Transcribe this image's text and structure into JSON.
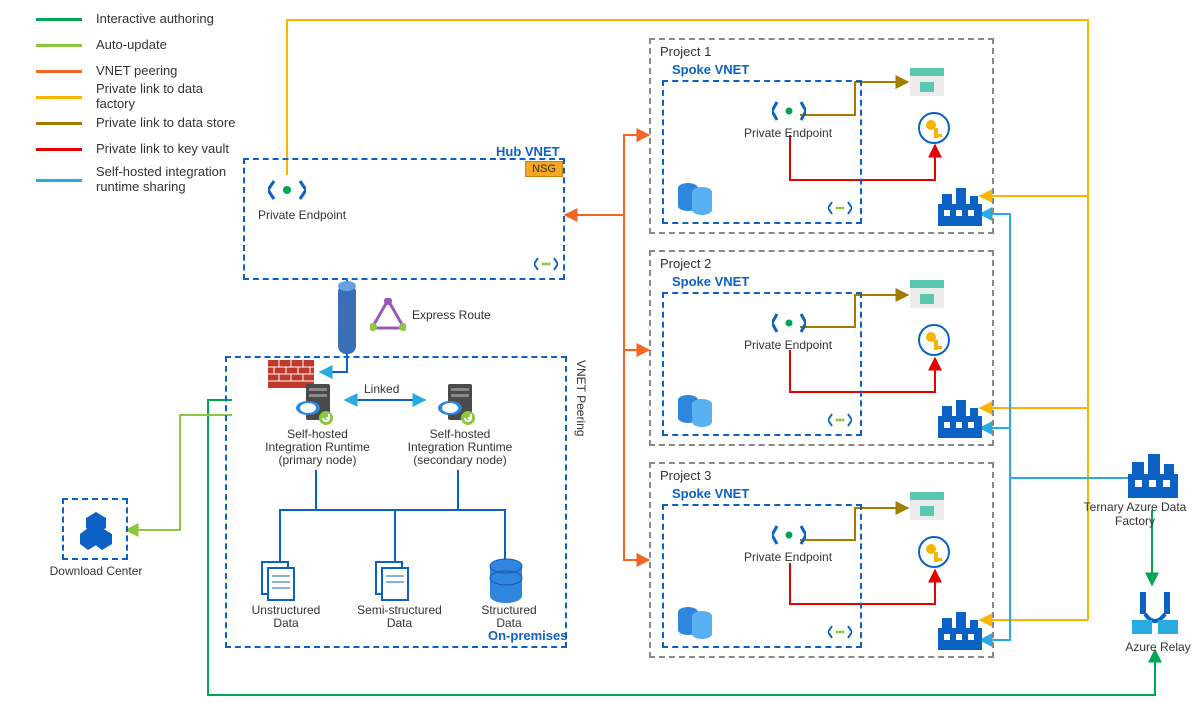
{
  "legend": {
    "items": [
      {
        "label": "Interactive authoring",
        "color": "#00a651"
      },
      {
        "label": "Auto-update",
        "color": "#8dc63f"
      },
      {
        "label": "VNET peering",
        "color": "#f26522"
      },
      {
        "label": "Private link to data factory",
        "color": "#f7b500"
      },
      {
        "label": "Private link to data store",
        "color": "#a67c00"
      },
      {
        "label": "Private link to key vault",
        "color": "#e60000"
      },
      {
        "label": "Self-hosted integration runtime sharing",
        "color": "#29abe2"
      }
    ]
  },
  "hub": {
    "title": "Hub VNET",
    "nsg": "NSG",
    "private_endpoint": "Private Endpoint"
  },
  "express_route": "Express Route",
  "onprem": {
    "title": "On-premises",
    "linked": "Linked",
    "shir_primary_1": "Self-hosted",
    "shir_primary_2": "Integration Runtime",
    "shir_primary_3": "(primary node)",
    "shir_secondary_1": "Self-hosted",
    "shir_secondary_2": "Integration Runtime",
    "shir_secondary_3": "(secondary node)",
    "unstructured": "Unstructured Data",
    "semi": "Semi-structured Data",
    "structured": "Structured Data"
  },
  "download_center": "Download Center",
  "projects": {
    "p1": {
      "title": "Project 1",
      "spoke": "Spoke VNET",
      "pe": "Private Endpoint"
    },
    "p2": {
      "title": "Project 2",
      "spoke": "Spoke VNET",
      "pe": "Private Endpoint"
    },
    "p3": {
      "title": "Project 3",
      "spoke": "Spoke VNET",
      "pe": "Private Endpoint"
    }
  },
  "ternary_adf": "Ternary Azure Data Factory",
  "azure_relay": "Azure Relay",
  "vnet_peering_vert": "VNET Peering"
}
